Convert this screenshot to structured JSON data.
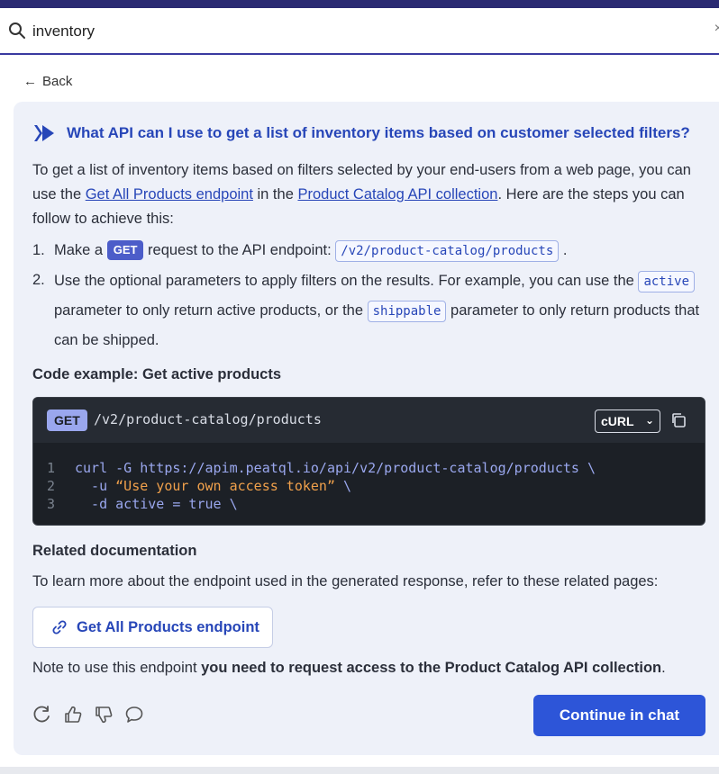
{
  "search": {
    "value": "inventory",
    "clear_glyph": "×"
  },
  "back": {
    "label": "Back",
    "icon": "arrow-left-icon"
  },
  "question": {
    "text": "What API can I use to get a list of inventory items based on customer selected filters?",
    "accent": "#2746b8"
  },
  "intro": {
    "part1": "To get a list of inventory items based on filters selected by your end-users from a web page, you can use the ",
    "link1": "Get All Products endpoint",
    "part2": " in the ",
    "link2": "Product Catalog API collection",
    "part3": ". Here are the steps you can follow to achieve this:"
  },
  "steps": [
    {
      "num": "1.",
      "pre": "Make a ",
      "badge": "GET",
      "mid": " request to the API endpoint: ",
      "chip": "/v2/product-catalog/products",
      "post": " ."
    },
    {
      "num": "2.",
      "pre": "Use the optional parameters to apply filters on the results. For example, you can use the ",
      "chip1": "active",
      "mid": " parameter to only return active products, or the ",
      "chip2": "shippable",
      "post": " parameter to only return products that can be shipped."
    }
  ],
  "code_example": {
    "heading": "Code example: Get active products",
    "method": "GET",
    "path": "/v2/product-catalog/products",
    "language": "cURL",
    "lines": [
      {
        "n": "1",
        "code": "curl -G https://apim.peatql.io/api/v2/product-catalog/products \\"
      },
      {
        "n": "2",
        "pre": "  -u ",
        "str": "“Use your own access token”",
        "post": " \\"
      },
      {
        "n": "3",
        "code": "  -d active = true \\"
      }
    ]
  },
  "related": {
    "heading": "Related documentation",
    "text": "To learn more about the endpoint used in the generated response, refer to these related pages:",
    "link_label": "Get All Products endpoint"
  },
  "note": {
    "pre": "Note to use this endpoint ",
    "bold": "you need to request access to the Product Catalog API collection",
    "post": "."
  },
  "actions": {
    "icons": [
      "refresh-icon",
      "thumbs-up-icon",
      "thumbs-down-icon",
      "comment-icon"
    ],
    "continue_label": "Continue in chat"
  },
  "colors": {
    "primary_button": "#2d55d8",
    "code_bg": "#1c2026",
    "panel_bg": "#eef1f9"
  }
}
